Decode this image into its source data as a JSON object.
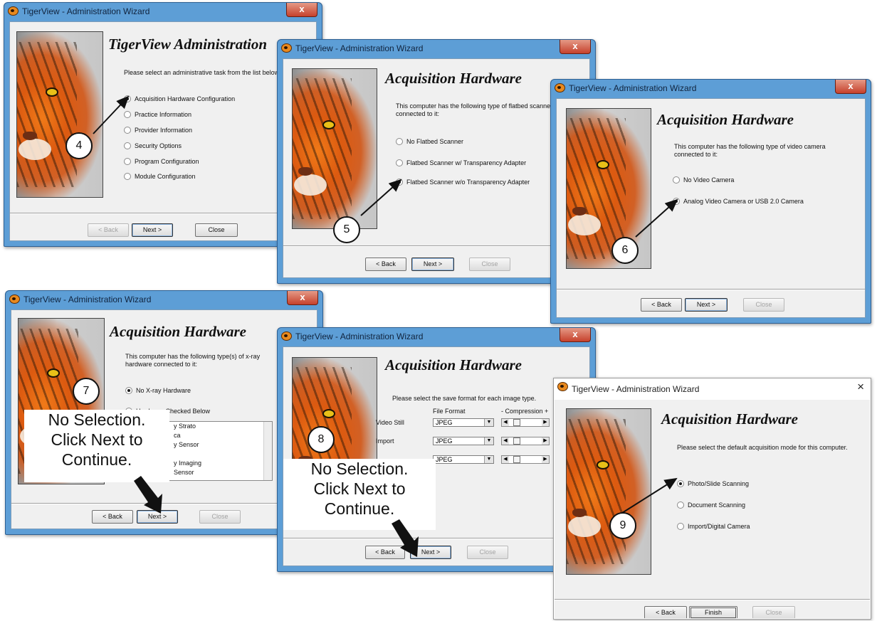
{
  "app_title": "TigerView - Administration Wizard",
  "close_glyph": "x",
  "wizard_steps": [
    {
      "step": "4",
      "heading": "TigerView Administration",
      "instruction": "Please select an administrative task from the list below and click Next> to continue.",
      "options": [
        "Acquisition Hardware Configuration",
        "Practice Information",
        "Provider Information",
        "Security Options",
        "Program Configuration",
        "Module Configuration"
      ],
      "selected": "Acquisition Hardware Configuration",
      "buttons": {
        "back": "< Back",
        "next": "Next >",
        "close": "Close"
      }
    },
    {
      "step": "5",
      "heading": "Acquisition Hardware",
      "instruction": "This computer has the following type of flatbed scanner connected to it:",
      "options": [
        "No Flatbed Scanner",
        "Flatbed Scanner w/ Transparency Adapter",
        "Flatbed Scanner w/o Transparency Adapter"
      ],
      "selected": "Flatbed Scanner w/o Transparency Adapter",
      "buttons": {
        "back": "< Back",
        "next": "Next >",
        "close": "Close"
      }
    },
    {
      "step": "6",
      "heading": "Acquisition Hardware",
      "instruction": "This computer has the following type of video camera connected to it:",
      "options": [
        "No Video Camera",
        "Analog Video Camera or USB 2.0 Camera"
      ],
      "selected": "Analog Video Camera or USB 2.0 Camera",
      "buttons": {
        "back": "< Back",
        "next": "Next >",
        "close": "Close"
      }
    },
    {
      "step": "7",
      "heading": "Acquisition Hardware",
      "instruction": "This computer has the following type(s) of x-ray hardware connected to it:",
      "options": [
        "No X-ray Hardware",
        "Hardware Checked Below"
      ],
      "selected": "No X-ray Hardware",
      "list_fragments": [
        "y Strato",
        "ca",
        "y Sensor",
        "",
        "y Imaging",
        "Sensor"
      ],
      "note": "No Selection.\nClick Next to\nContinue.",
      "buttons": {
        "back": "< Back",
        "next": "Next >",
        "close": "Close"
      }
    },
    {
      "step": "8",
      "heading": "Acquisition Hardware",
      "instruction": "Please select the save format for each image type.",
      "column_headers": {
        "format": "File Format",
        "compression": "- Compression +"
      },
      "rows": [
        {
          "label": "Video Still",
          "format": "JPEG"
        },
        {
          "label": "Import",
          "format": "JPEG"
        },
        {
          "label": "",
          "format": "JPEG"
        }
      ],
      "note": "No Selection.\nClick Next to\nContinue.",
      "buttons": {
        "back": "< Back",
        "next": "Next >",
        "close": "Close"
      }
    },
    {
      "step": "9",
      "heading": "Acquisition Hardware",
      "instruction": "Please select the default acquisition mode for this computer.",
      "options": [
        "Photo/Slide Scanning",
        "Document Scanning",
        "Import/Digital Camera"
      ],
      "selected": "Photo/Slide Scanning",
      "buttons": {
        "back": "< Back",
        "next": "Finish",
        "close": "Close"
      }
    }
  ],
  "icons": [
    "tiger-app-icon",
    "close-icon",
    "radio-icon",
    "dropdown-arrow-icon",
    "callout-arrow-icon"
  ]
}
